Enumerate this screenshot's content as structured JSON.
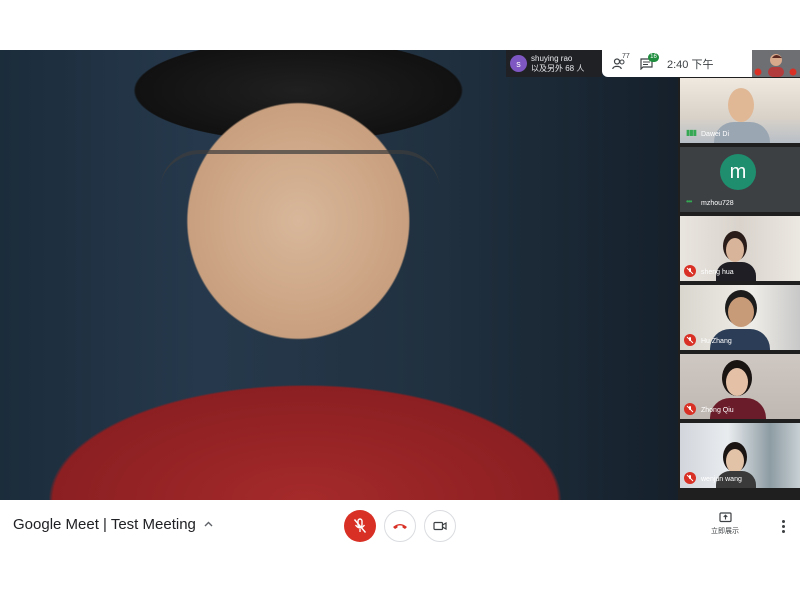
{
  "presenter": {
    "avatar_letter": "s",
    "name": "shuying rao",
    "others": "以及另外 68 人"
  },
  "info_bar": {
    "people_count": "77",
    "chat_count": "16",
    "time": "2:40",
    "period": "下午"
  },
  "participants": [
    {
      "name": "Dawei Di",
      "status": "speaking"
    },
    {
      "name": "mzhou728",
      "avatar_letter": "m",
      "status": "speaking"
    },
    {
      "name": "sheng hua",
      "status": "muted"
    },
    {
      "name": "Hu Zhang",
      "status": "muted"
    },
    {
      "name": "Zhong Qiu",
      "status": "muted"
    },
    {
      "name": "wenjun wang",
      "status": "muted"
    }
  ],
  "bottom_bar": {
    "meeting_title": "Google Meet | Test Meeting",
    "present_label": "立即展示"
  },
  "colors": {
    "mute_red": "#d93025",
    "chat_badge": "#1e8e3e",
    "avatar_green": "#1e8e6e"
  }
}
